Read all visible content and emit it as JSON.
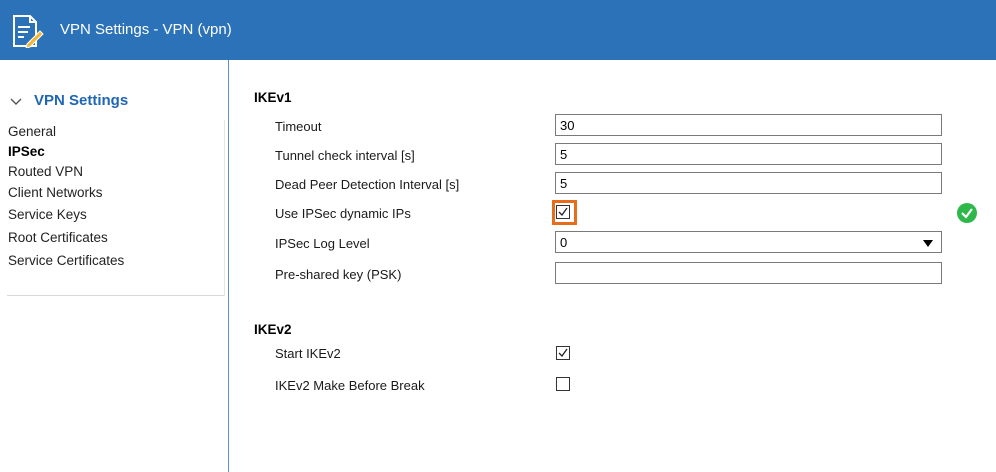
{
  "window": {
    "title": "VPN Settings - VPN (vpn)",
    "icon": "document-edit-icon"
  },
  "sidebar": {
    "section_title": "VPN Settings",
    "items": [
      {
        "label": "General",
        "active": false
      },
      {
        "label": "IPSec",
        "active": true
      },
      {
        "label": "Routed VPN",
        "active": false
      },
      {
        "label": "Client Networks",
        "active": false
      },
      {
        "label": "Service Keys",
        "active": false
      },
      {
        "label": "Root Certificates",
        "active": false
      },
      {
        "label": "Service Certificates",
        "active": false
      }
    ]
  },
  "ikev1": {
    "title": "IKEv1",
    "timeout": {
      "label": "Timeout",
      "value": "30"
    },
    "tunnel_check": {
      "label": "Tunnel check interval [s]",
      "value": "5"
    },
    "dpd": {
      "label": "Dead Peer Detection Interval [s]",
      "value": "5"
    },
    "dynamic_ips": {
      "label": "Use IPSec dynamic IPs",
      "checked": true
    },
    "log_level": {
      "label": "IPSec Log Level",
      "value": "0"
    },
    "psk": {
      "label": "Pre-shared key (PSK)",
      "value": ""
    }
  },
  "ikev2": {
    "title": "IKEv2",
    "start": {
      "label": "Start IKEv2",
      "checked": true
    },
    "make_before_break": {
      "label": "IKEv2 Make Before Break",
      "checked": false
    }
  },
  "colors": {
    "titlebar": "#2b72b8",
    "section_title": "#1f66b5",
    "focus": "#e86d1a",
    "ok": "#2fb84a"
  }
}
